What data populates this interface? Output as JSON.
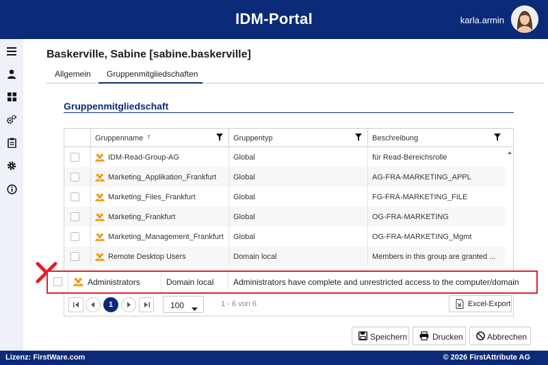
{
  "header": {
    "title": "IDM-Portal",
    "user": "karla.armin"
  },
  "person": {
    "title": "Baskerville, Sabine [sabine.baskerville]"
  },
  "tabs": [
    {
      "label": "Allgemein"
    },
    {
      "label": "Gruppenmitgliedschaften"
    }
  ],
  "section": {
    "title": "Gruppenmitgliedschaft"
  },
  "table": {
    "columns": [
      {
        "label": "Gruppenname"
      },
      {
        "label": "Gruppentyp"
      },
      {
        "label": "Beschreibung"
      }
    ],
    "sort_indicator": "↑",
    "rows": [
      {
        "name": "IDM-Read-Group-AG",
        "type": "Global",
        "description": "für Read-Bereichsrolle"
      },
      {
        "name": "Marketing_Applikation_Frankfurt",
        "type": "Global",
        "description": "AG-FRA-MARKETING_APPL"
      },
      {
        "name": "Marketing_Files_Frankfurt",
        "type": "Global",
        "description": "FG-FRA-MARKETING_FILE"
      },
      {
        "name": "Marketing_Frankfurt",
        "type": "Global",
        "description": "OG-FRA-MARKETING"
      },
      {
        "name": "Marketing_Management_Frankfurt",
        "type": "Global",
        "description": "OG-FRA-MARKETING_Mgmt"
      },
      {
        "name": "Remote Desktop Users",
        "type": "Domain local",
        "description": "Members in this group are granted ..."
      }
    ]
  },
  "overlay_row": {
    "name": "Administrators",
    "type": "Domain local",
    "description": "Administrators have complete and unrestricted access to the computer/domain"
  },
  "pager": {
    "current_page": "1",
    "page_size": "100",
    "info": "1 - 6 von 6",
    "excel_label": "Excel-Export"
  },
  "actions": {
    "save": "Speichern",
    "print": "Drucken",
    "cancel": "Abbrechen"
  },
  "footer": {
    "license": "Lizenz: FirstWare.com",
    "copyright": "© 2026 FirstAttribute AG"
  },
  "colors": {
    "primary": "#0b2a78",
    "accent_red": "#e01e2a",
    "group_icon": "#f0a020"
  },
  "icons": {
    "sidebar": [
      "menu-icon",
      "user-icon",
      "dashboard-icon",
      "settings-gears-icon",
      "clipboard-icon",
      "gear-icon",
      "info-icon"
    ],
    "group": "group-icon",
    "filter": "filter-icon"
  }
}
